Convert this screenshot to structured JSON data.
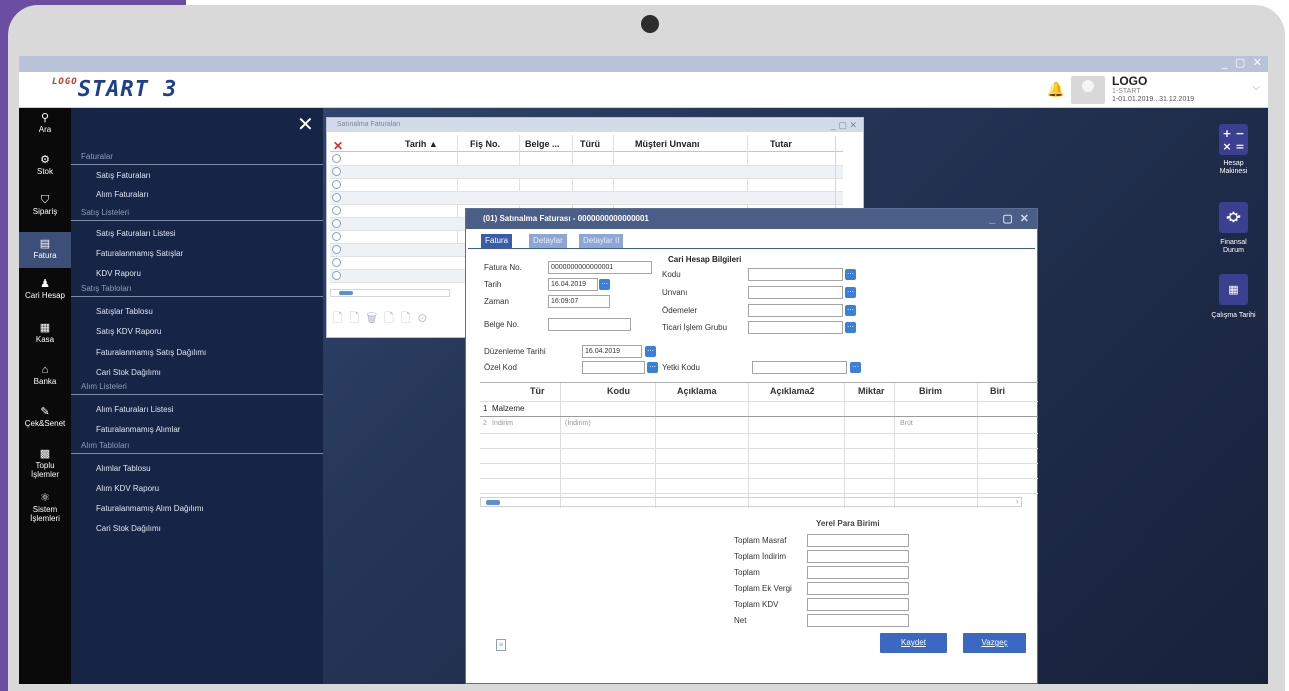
{
  "app": {
    "logo_prefix": "LOGO",
    "logo_text": "START 3",
    "window_controls": "_ ▢ ✕"
  },
  "user": {
    "name": "LOGO",
    "firm": "1-START",
    "period": "1-01.01.2019...31.12.2019"
  },
  "left_nav": [
    {
      "label": "Ara",
      "icon": "search-icon"
    },
    {
      "label": "Stok",
      "icon": "stock-icon"
    },
    {
      "label": "Sipariş",
      "icon": "cart-icon"
    },
    {
      "label": "Fatura",
      "icon": "invoice-icon",
      "active": true
    },
    {
      "label": "Cari Hesap",
      "icon": "person-icon"
    },
    {
      "label": "Kasa",
      "icon": "cashbox-icon"
    },
    {
      "label": "Banka",
      "icon": "bank-icon"
    },
    {
      "label": "Çek&Senet",
      "icon": "cheque-icon"
    },
    {
      "label": "Toplu İşlemler",
      "icon": "grid-icon"
    },
    {
      "label": "Sistem İşlemleri",
      "icon": "system-icon"
    }
  ],
  "menu": {
    "sections": [
      {
        "title": "Faturalar",
        "items": [
          "Satış Faturaları",
          "Alım Faturaları"
        ]
      },
      {
        "title": "Satış Listeleri",
        "items": [
          "Satış Faturaları Listesi",
          "Faturalanmamış Satışlar",
          "KDV Raporu"
        ]
      },
      {
        "title": "Satış Tabloları",
        "items": [
          "Satışlar Tablosu",
          "Satış KDV Raporu",
          "Faturalanmamış Satış Dağılımı",
          "Cari Stok Dağılımı"
        ]
      },
      {
        "title": "Alım Listeleri",
        "items": [
          "Alım Faturaları Listesi",
          "Faturalanmamış Alımlar"
        ]
      },
      {
        "title": "Alım Tabloları",
        "items": [
          "Alımlar Tablosu",
          "Alım KDV Raporu",
          "Faturalanmamış Alım Dağılımı",
          "Cari Stok Dağılımı"
        ]
      }
    ]
  },
  "right_bar": [
    {
      "label": "Hesap Makinesi",
      "glyph": "+−×="
    },
    {
      "label": "Finansal Durum",
      "glyph": "♾"
    },
    {
      "label": "Çalışma Tarihi",
      "glyph": "21"
    }
  ],
  "back_window": {
    "title": "Satınalma Faturaları",
    "columns": [
      "Tarih ▲",
      "Fiş No.",
      "Belge ...",
      "Türü",
      "Müşteri Unvanı",
      "Tutar"
    ]
  },
  "dialog": {
    "title": "(01) Satınalma Faturası - 0000000000000001",
    "tabs": [
      "Fatura",
      "Detaylar",
      "Detaylar II"
    ],
    "fields": {
      "fatura_no_label": "Fatura No.",
      "fatura_no": "0000000000000001",
      "tarih_label": "Tarih",
      "tarih": "16.04.2019",
      "zaman_label": "Zaman",
      "zaman": "16:09:07",
      "belge_no_label": "Belge No.",
      "belge_no": "",
      "duzenleme_label": "Düzenleme Tarihi",
      "duzenleme": "16.04.2019",
      "ozel_kod_label": "Özel Kod",
      "yetki_kodu_label": "Yetki Kodu"
    },
    "cari": {
      "title": "Cari Hesap Bilgileri",
      "kodu": "Kodu",
      "unvani": "Unvanı",
      "odemeler": "Ödemeler",
      "ticari": "Ticari İşlem Grubu"
    },
    "grid": {
      "columns": [
        "Tür",
        "Kodu",
        "Açıklama",
        "Açıklama2",
        "Miktar",
        "Birim",
        "Biri"
      ],
      "rows": [
        {
          "no": "1",
          "tur": "Malzeme",
          "kodu": "",
          "birim": ""
        },
        {
          "no": "2",
          "tur": "İndirim",
          "kodu": "(İndirim)",
          "birim": "Brüt"
        }
      ]
    },
    "totals": {
      "title": "Yerel Para Birimi",
      "labels": [
        "Toplam Masraf",
        "Toplam İndirim",
        "Toplam",
        "Toplam Ek Vergi",
        "Toplam KDV",
        "Net"
      ]
    },
    "buttons": {
      "save": "Kaydet",
      "cancel": "Vazgeç"
    }
  }
}
